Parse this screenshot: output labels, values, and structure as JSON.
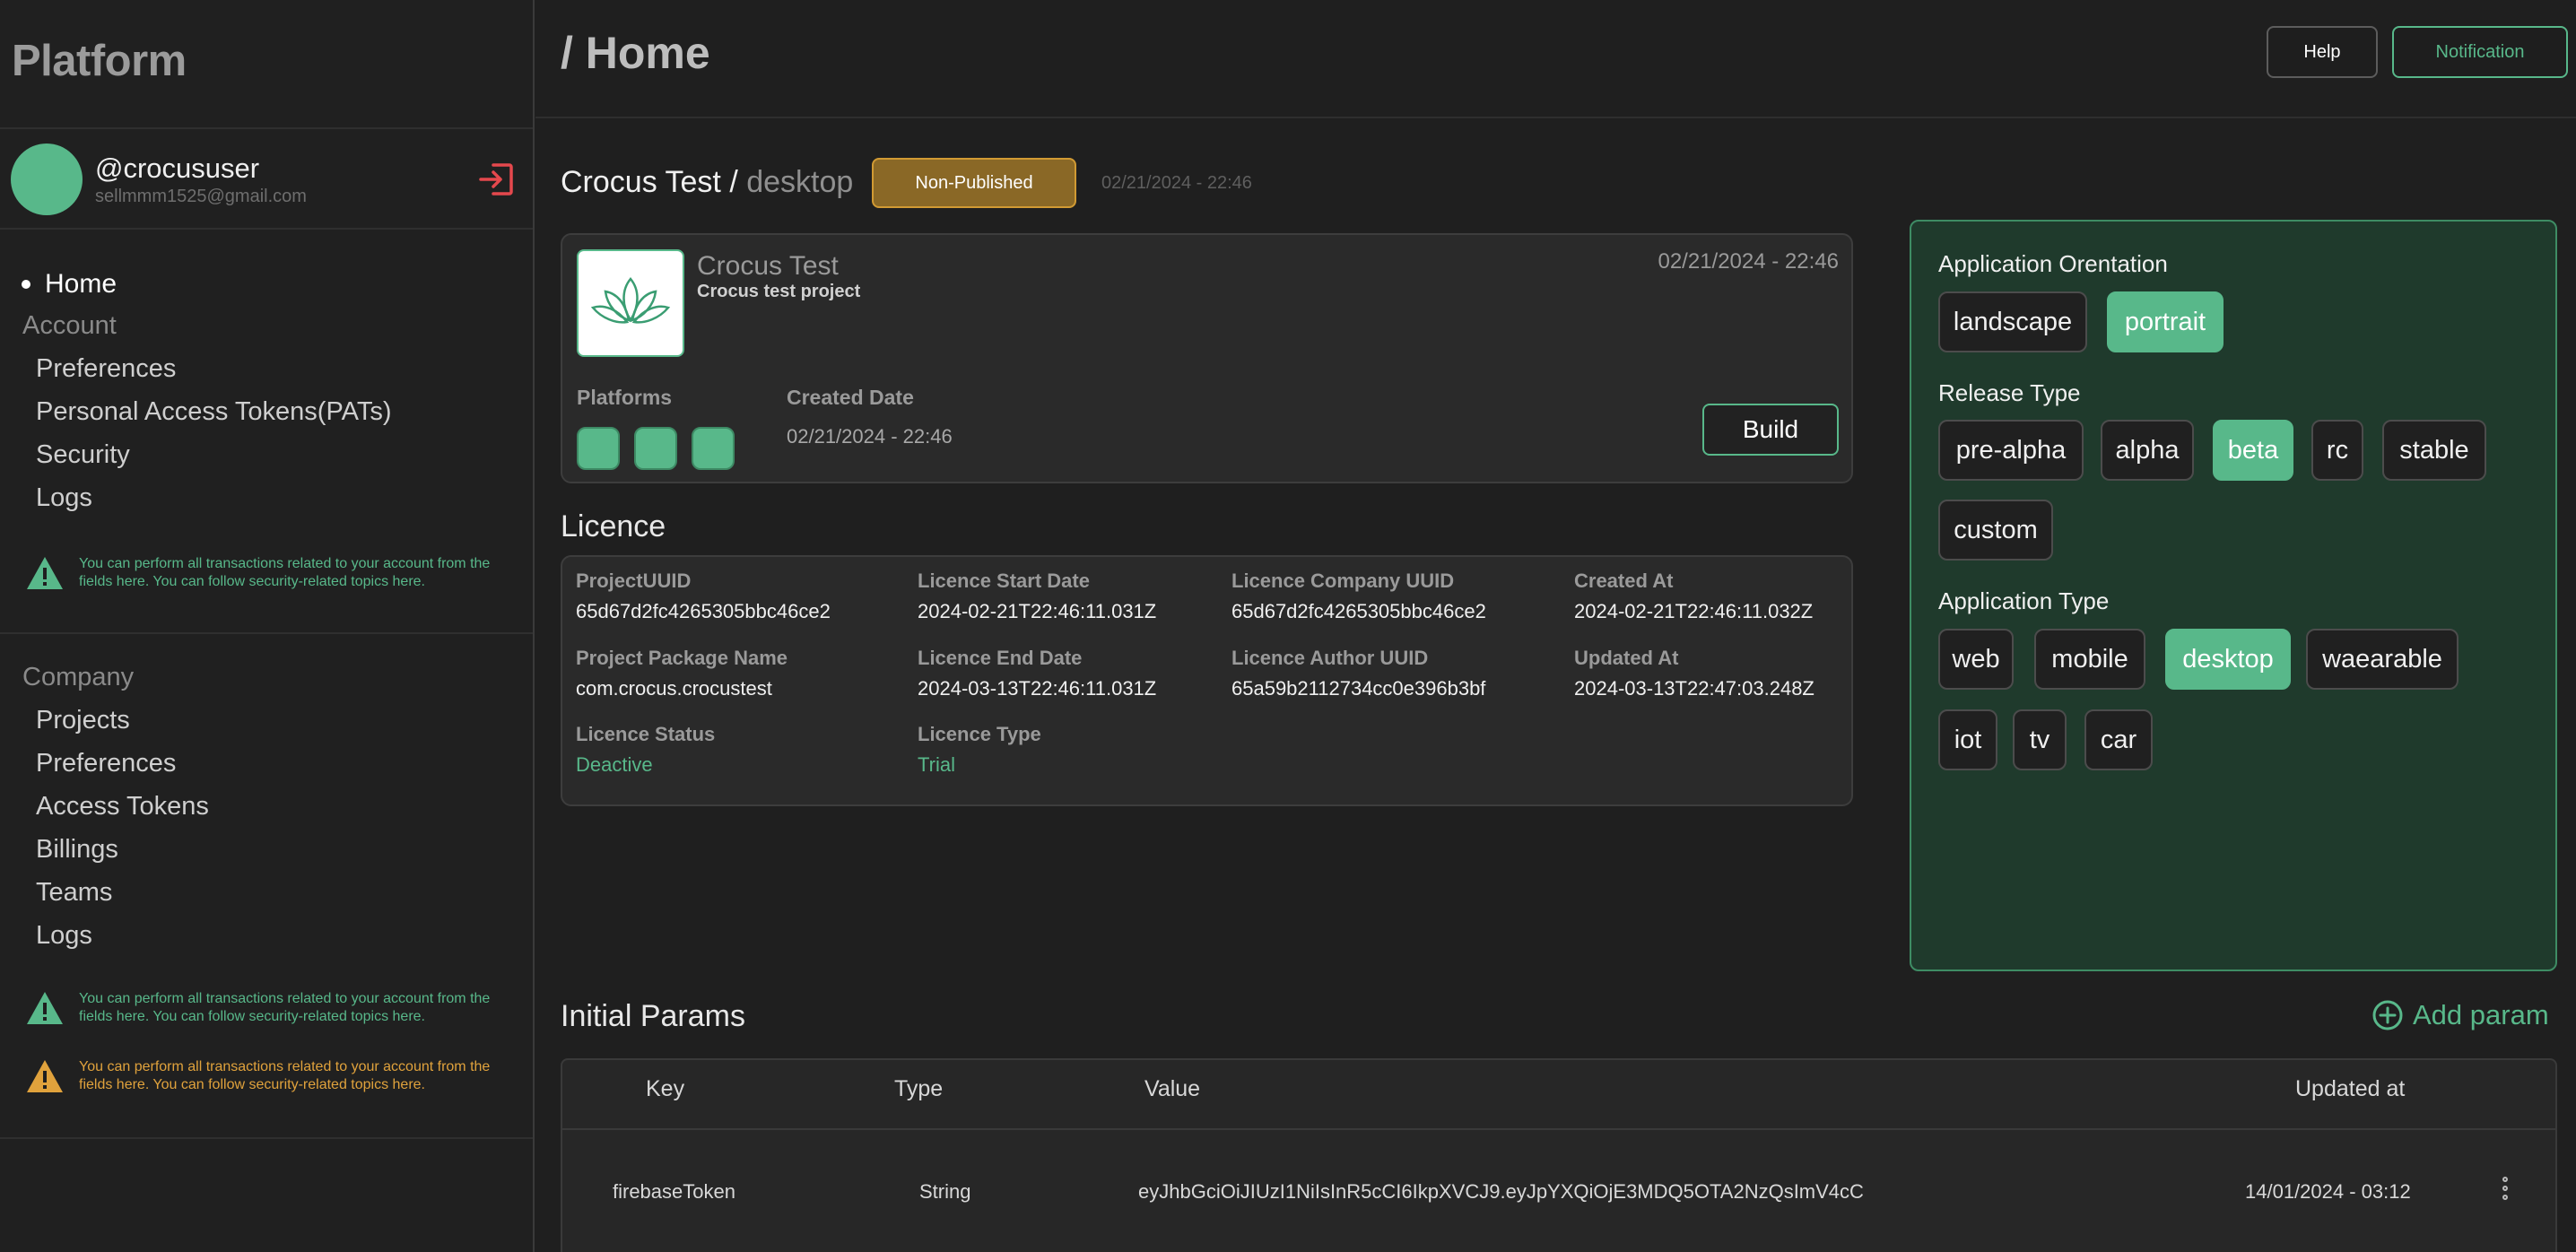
{
  "sidebar": {
    "brand": "Platform",
    "user": {
      "handle": "@crocususer",
      "email": "sellmmm1525@gmail.com"
    },
    "home": "Home",
    "account": {
      "title": "Account",
      "items": [
        "Preferences",
        "Personal Access Tokens(PATs)",
        "Security",
        "Logs"
      ],
      "notice": "You can perform all transactions related to your account from the fields here. You can follow security-related topics here."
    },
    "company": {
      "title": "Company",
      "items": [
        "Projects",
        "Preferences",
        "Access Tokens",
        "Billings",
        "Teams",
        "Logs"
      ],
      "notice_green": "You can perform all transactions related to your account from the fields here. You can follow security-related topics here.",
      "notice_orange": "You can perform all transactions related to your account from the fields here. You can follow security-related topics here."
    }
  },
  "header": {
    "title": "/ Home",
    "help": "Help",
    "notification": "Notification"
  },
  "project": {
    "name": "Crocus Test /",
    "platform": "desktop",
    "status": "Non-Published",
    "date": "02/21/2024 - 22:46",
    "card": {
      "name": "Crocus Test",
      "description": "Crocus test project",
      "date": "02/21/2024 - 22:46",
      "platforms_label": "Platforms",
      "created_label": "Created Date",
      "created_value": "02/21/2024 - 22:46",
      "build": "Build"
    }
  },
  "licence": {
    "title": "Licence",
    "fields": {
      "project_uuid": {
        "label": "ProjectUUID",
        "value": "65d67d2fc4265305bbc46ce2"
      },
      "start": {
        "label": "Licence Start Date",
        "value": "2024-02-21T22:46:11.031Z"
      },
      "company_uuid": {
        "label": "Licence Company UUID",
        "value": "65d67d2fc4265305bbc46ce2"
      },
      "created_at": {
        "label": "Created At",
        "value": "2024-02-21T22:46:11.032Z"
      },
      "package": {
        "label": "Project Package Name",
        "value": "com.crocus.crocustest"
      },
      "end": {
        "label": "Licence End Date",
        "value": "2024-03-13T22:46:11.031Z"
      },
      "author_uuid": {
        "label": "Licence Author UUID",
        "value": "65a59b2112734cc0e396b3bf"
      },
      "updated_at": {
        "label": "Updated At",
        "value": "2024-03-13T22:47:03.248Z"
      },
      "status": {
        "label": "Licence Status",
        "value": "Deactive"
      },
      "type": {
        "label": "Licence Type",
        "value": "Trial"
      }
    }
  },
  "options": {
    "orientation": {
      "title": "Application Orentation",
      "items": [
        "landscape",
        "portrait"
      ],
      "selected": "portrait"
    },
    "release": {
      "title": "Release Type",
      "items": [
        "pre-alpha",
        "alpha",
        "beta",
        "rc",
        "stable",
        "custom"
      ],
      "selected": "beta"
    },
    "app_type": {
      "title": "Application Type",
      "items": [
        "web",
        "mobile",
        "desktop",
        "waearable",
        "iot",
        "tv",
        "car"
      ],
      "selected": "desktop"
    }
  },
  "params": {
    "title": "Initial Params",
    "add": "Add param",
    "columns": [
      "Key",
      "Type",
      "Value",
      "Updated at"
    ],
    "rows": [
      {
        "key": "firebaseToken",
        "type": "String",
        "value": "eyJhbGciOiJIUzI1NiIsInR5cCI6IkpXVCJ9.eyJpYXQiOjE3MDQ5OTA2NzQsImV4cC",
        "updated": "14/01/2024 - 03:12"
      }
    ]
  },
  "colors": {
    "accent": "#58b88a",
    "warning": "#e0a23c",
    "danger": "#e5484d"
  }
}
